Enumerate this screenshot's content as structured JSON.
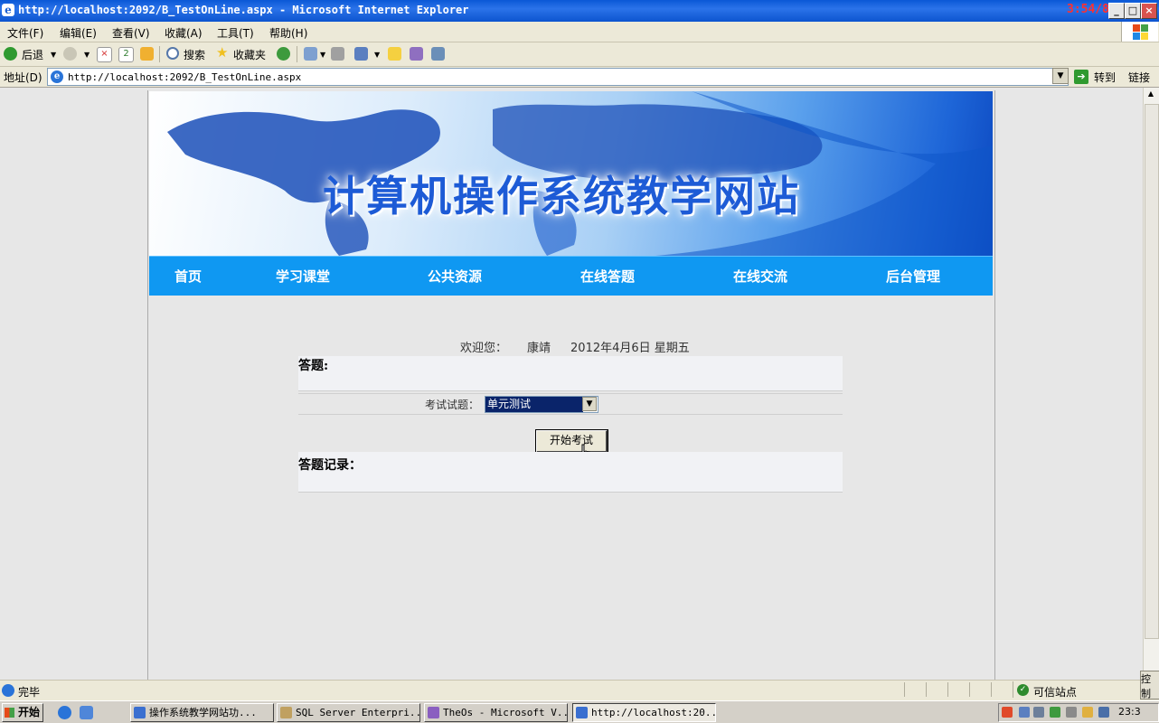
{
  "window": {
    "title": "http://localhost:2092/B_TestOnLine.aspx - Microsoft Internet Explorer",
    "clock_overlay": "3:54/8:32",
    "min": "_",
    "max": "□",
    "close": "×"
  },
  "menubar": [
    "文件(F)",
    "编辑(E)",
    "查看(V)",
    "收藏(A)",
    "工具(T)",
    "帮助(H)"
  ],
  "toolbar": {
    "back": "后退",
    "search": "搜索",
    "favorites": "收藏夹"
  },
  "address": {
    "label": "地址(D)",
    "url": "http://localhost:2092/B_TestOnLine.aspx",
    "go": "转到",
    "links": "链接"
  },
  "site": {
    "banner_title": "计算机操作系统教学网站",
    "nav": [
      "首页",
      "学习课堂",
      "公共资源",
      "在线答题",
      "在线交流",
      "后台管理"
    ],
    "welcome_prefix": "欢迎您：",
    "username": "康靖",
    "date": "2012年4月6日 星期五",
    "answer_heading": "答题:",
    "exam_label": "考试试题：",
    "exam_selected": "单元测试",
    "start_button": "开始考试",
    "records_heading": "答题记录："
  },
  "statusbar": {
    "status": "完毕",
    "zone": "可信站点",
    "side_tab": "控制"
  },
  "taskbar": {
    "start": "开始",
    "tasks": [
      {
        "label": "操作系统教学网站功...",
        "active": false
      },
      {
        "label": "SQL Server Enterpri...",
        "active": false
      },
      {
        "label": "TheOs - Microsoft V...",
        "active": false
      },
      {
        "label": "http://localhost:20...",
        "active": true
      }
    ],
    "clock": "23:3"
  },
  "colors": {
    "nav_bg": "#0f98f2",
    "banner_title": "#1d5bd6",
    "select_highlight": "#0a246a"
  }
}
